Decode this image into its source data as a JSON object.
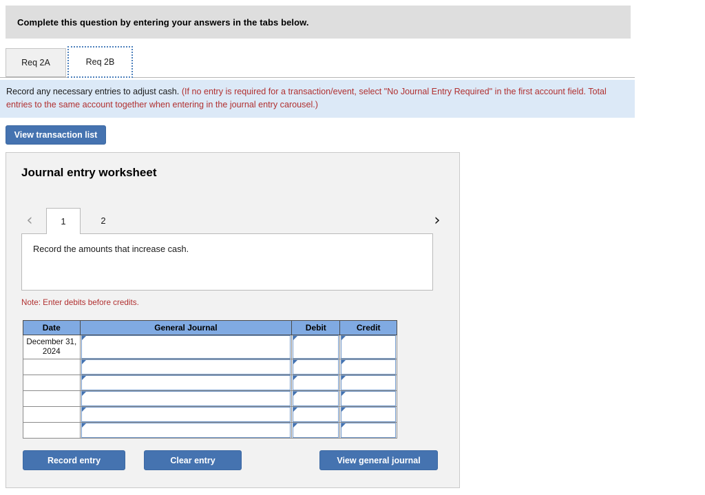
{
  "banner": {
    "text": "Complete this question by entering your answers in the tabs below."
  },
  "tabs": [
    {
      "label": "Req 2A",
      "active": false
    },
    {
      "label": "Req 2B",
      "active": true
    }
  ],
  "instruction": {
    "lead": "Record any necessary entries to adjust cash.",
    "paren": "(If no entry is required for a transaction/event, select \"No Journal Entry Required\" in the first account field. Total entries to the same account together when entering in the journal entry carousel.)"
  },
  "toolbar": {
    "view_transaction_list_label": "View transaction list"
  },
  "worksheet": {
    "title": "Journal entry worksheet",
    "carousel": {
      "prev_icon": "chevron-left-icon",
      "next_icon": "chevron-right-icon",
      "pages": [
        {
          "label": "1",
          "active": true
        },
        {
          "label": "2",
          "active": false
        }
      ]
    },
    "prompt": "Record the amounts that increase cash.",
    "note": "Note: Enter debits before credits.",
    "table": {
      "columns": [
        "Date",
        "General Journal",
        "Debit",
        "Credit"
      ],
      "rows": [
        {
          "date": "December 31, 2024",
          "general_journal": "",
          "debit": "",
          "credit": "",
          "tall": true
        },
        {
          "date": "",
          "general_journal": "",
          "debit": "",
          "credit": "",
          "tall": false
        },
        {
          "date": "",
          "general_journal": "",
          "debit": "",
          "credit": "",
          "tall": false
        },
        {
          "date": "",
          "general_journal": "",
          "debit": "",
          "credit": "",
          "tall": false
        },
        {
          "date": "",
          "general_journal": "",
          "debit": "",
          "credit": "",
          "tall": false
        },
        {
          "date": "",
          "general_journal": "",
          "debit": "",
          "credit": "",
          "tall": false
        }
      ]
    },
    "buttons": {
      "record_entry": "Record entry",
      "clear_entry": "Clear entry",
      "view_general_journal": "View general journal"
    }
  },
  "colors": {
    "accent_blue": "#4573b0",
    "table_header_blue": "#80aae2",
    "instruction_bg": "#dce9f7",
    "banner_bg": "#dedede",
    "panel_bg": "#f2f2f2",
    "note_red": "#b03030"
  }
}
